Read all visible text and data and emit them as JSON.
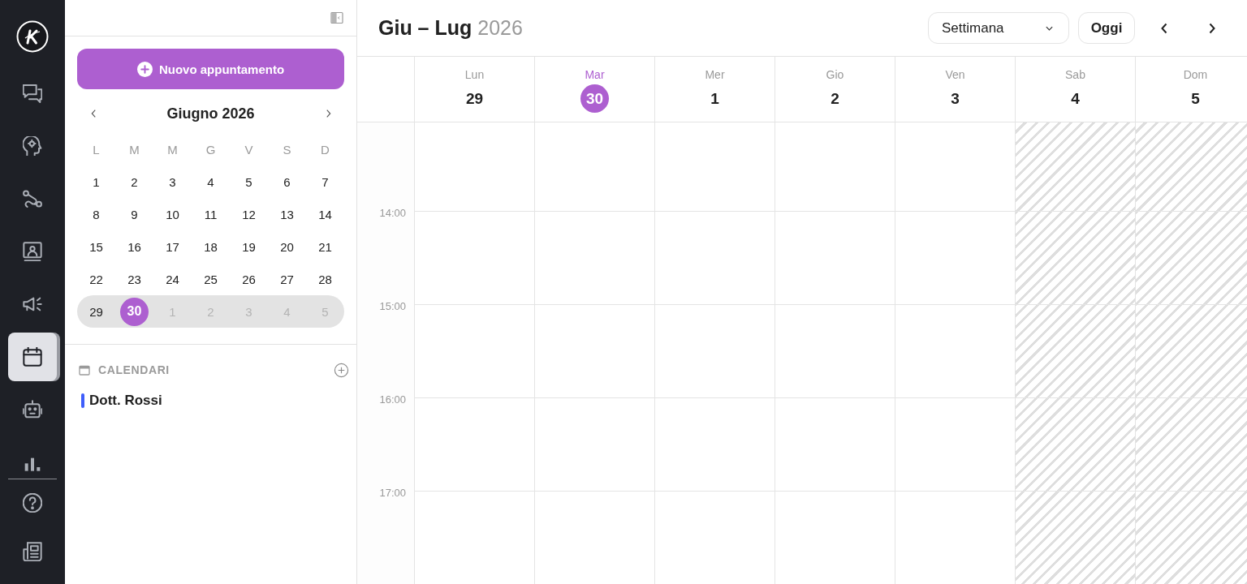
{
  "rail": {
    "items": [
      {
        "selected": false
      },
      {
        "selected": false
      },
      {
        "selected": false
      },
      {
        "selected": false
      },
      {
        "selected": false
      },
      {
        "selected": true
      },
      {
        "selected": false
      },
      {
        "selected": false
      }
    ],
    "footer_items": [
      {
        "selected": false
      },
      {
        "selected": false
      }
    ]
  },
  "sidebar": {
    "new_button": "Nuovo appuntamento",
    "mini_calendar": {
      "title": "Giugno 2026",
      "weekdays": [
        "L",
        "M",
        "M",
        "G",
        "V",
        "S",
        "D"
      ],
      "weeks": [
        {
          "current": false,
          "days": [
            {
              "label": "1",
              "selected": false,
              "outside": false
            },
            {
              "label": "2",
              "selected": false,
              "outside": false
            },
            {
              "label": "3",
              "selected": false,
              "outside": false
            },
            {
              "label": "4",
              "selected": false,
              "outside": false
            },
            {
              "label": "5",
              "selected": false,
              "outside": false
            },
            {
              "label": "6",
              "selected": false,
              "outside": false
            },
            {
              "label": "7",
              "selected": false,
              "outside": false
            }
          ]
        },
        {
          "current": false,
          "days": [
            {
              "label": "8",
              "selected": false,
              "outside": false
            },
            {
              "label": "9",
              "selected": false,
              "outside": false
            },
            {
              "label": "10",
              "selected": false,
              "outside": false
            },
            {
              "label": "11",
              "selected": false,
              "outside": false
            },
            {
              "label": "12",
              "selected": false,
              "outside": false
            },
            {
              "label": "13",
              "selected": false,
              "outside": false
            },
            {
              "label": "14",
              "selected": false,
              "outside": false
            }
          ]
        },
        {
          "current": false,
          "days": [
            {
              "label": "15",
              "selected": false,
              "outside": false
            },
            {
              "label": "16",
              "selected": false,
              "outside": false
            },
            {
              "label": "17",
              "selected": false,
              "outside": false
            },
            {
              "label": "18",
              "selected": false,
              "outside": false
            },
            {
              "label": "19",
              "selected": false,
              "outside": false
            },
            {
              "label": "20",
              "selected": false,
              "outside": false
            },
            {
              "label": "21",
              "selected": false,
              "outside": false
            }
          ]
        },
        {
          "current": false,
          "days": [
            {
              "label": "22",
              "selected": false,
              "outside": false
            },
            {
              "label": "23",
              "selected": false,
              "outside": false
            },
            {
              "label": "24",
              "selected": false,
              "outside": false
            },
            {
              "label": "25",
              "selected": false,
              "outside": false
            },
            {
              "label": "26",
              "selected": false,
              "outside": false
            },
            {
              "label": "27",
              "selected": false,
              "outside": false
            },
            {
              "label": "28",
              "selected": false,
              "outside": false
            }
          ]
        },
        {
          "current": true,
          "days": [
            {
              "label": "29",
              "selected": false,
              "outside": false
            },
            {
              "label": "30",
              "selected": true,
              "outside": false
            },
            {
              "label": "1",
              "selected": false,
              "outside": true
            },
            {
              "label": "2",
              "selected": false,
              "outside": true
            },
            {
              "label": "3",
              "selected": false,
              "outside": true
            },
            {
              "label": "4",
              "selected": false,
              "outside": true
            },
            {
              "label": "5",
              "selected": false,
              "outside": true
            }
          ]
        }
      ]
    },
    "calendars": {
      "title": "CALENDARI",
      "items": [
        {
          "name": "Dott. Rossi",
          "color": "#3f5efb"
        }
      ]
    }
  },
  "main": {
    "title": "Giu – Lug",
    "year": "2026",
    "view": "Settimana",
    "today_button": "Oggi",
    "days": [
      {
        "name": "Lun",
        "number": "29",
        "today": false,
        "weekend": false
      },
      {
        "name": "Mar",
        "number": "30",
        "today": true,
        "weekend": false
      },
      {
        "name": "Mer",
        "number": "1",
        "today": false,
        "weekend": false
      },
      {
        "name": "Gio",
        "number": "2",
        "today": false,
        "weekend": false
      },
      {
        "name": "Ven",
        "number": "3",
        "today": false,
        "weekend": false
      },
      {
        "name": "Sab",
        "number": "4",
        "today": false,
        "weekend": true
      },
      {
        "name": "Dom",
        "number": "5",
        "today": false,
        "weekend": true
      }
    ],
    "hours": [
      "14:00",
      "15:00",
      "16:00",
      "17:00"
    ]
  }
}
